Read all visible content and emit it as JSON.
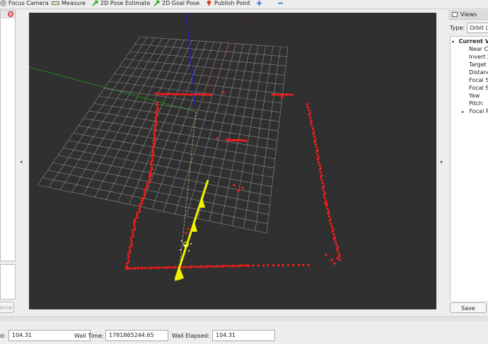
{
  "toolbar": {
    "focus_camera": "Focus Camera",
    "measure": "Measure",
    "pose_estimate": "2D Pose Estimate",
    "goal_pose": "2D Goal Pose",
    "publish_point": "Publish Point"
  },
  "left_panel": {
    "bottom_button": "ame"
  },
  "views_panel": {
    "title": "Views",
    "type_label": "Type:",
    "type_value": "Orbit (",
    "tree": {
      "group": "Current V",
      "items": [
        "Near C",
        "Invert Z",
        "Target",
        "Distance",
        "Focal S",
        "Focal S",
        "Yaw",
        "Pitch"
      ],
      "last_item": "Focal P"
    },
    "save_label": "Save"
  },
  "status": {
    "ros_elapsed_label": "d:",
    "ros_elapsed_value": "104.31",
    "wall_time_label": "Wall Time:",
    "wall_time_value": "1781865244.65",
    "wall_elapsed_label": "Wall Elapsed:",
    "wall_elapsed_value": "104.31"
  },
  "colors": {
    "viewport_bg": "#303030",
    "grid": "#a0a0a0",
    "scan_points": "#ff1a1a",
    "path_arrow": "#f2f200",
    "x_axis": "#1fae1f",
    "y_axis": "#a51212",
    "z_axis": "#1a1ad0"
  }
}
